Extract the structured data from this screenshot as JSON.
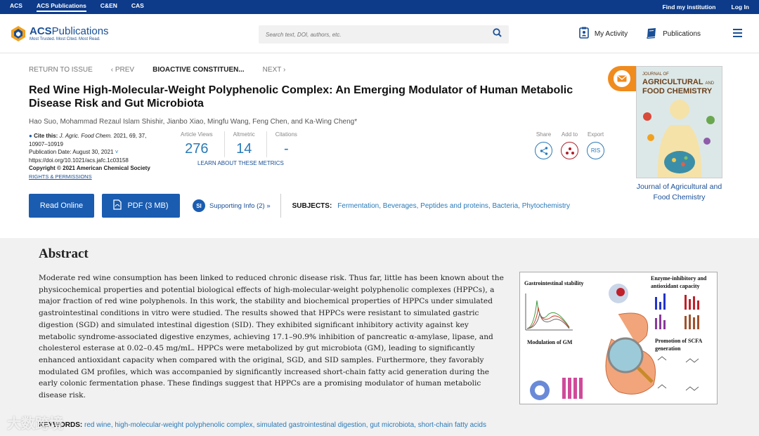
{
  "topbar": {
    "links": [
      "ACS",
      "ACS Publications",
      "C&EN",
      "CAS"
    ],
    "right": [
      "Find my institution",
      "Log In"
    ]
  },
  "header": {
    "logo_name": "ACS",
    "logo_name2": "Publications",
    "logo_tag": "Most Trusted. Most Cited. Most Read.",
    "search_placeholder": "Search text, DOI, authors, etc.",
    "my_activity": "My Activity",
    "publications": "Publications"
  },
  "nav": {
    "return": "RETURN TO ISSUE",
    "prev": "‹ PREV",
    "current": "BIOACTIVE CONSTITUEN...",
    "next": "NEXT ›"
  },
  "article": {
    "title": "Red Wine High-Molecular-Weight Polyphenolic Complex: An Emerging Modulator of Human Metabolic Disease Risk and Gut Microbiota",
    "authors": "Hao Suo, Mohammad Rezaul Islam Shishir, Jianbo Xiao, Mingfu Wang, Feng Chen, and Ka-Wing Cheng*",
    "cite_label": "Cite this:",
    "cite_journal": "J. Agric. Food Chem.",
    "cite_rest": "2021, 69, 37,",
    "pages": "10907–10919",
    "pub_date": "Publication Date: August 30, 2021",
    "doi": "https://doi.org/10.1021/acs.jafc.1c03158",
    "copyright": "Copyright © 2021 American Chemical Society",
    "rights": "RIGHTS & PERMISSIONS"
  },
  "metrics": [
    {
      "label": "Article Views",
      "value": "276"
    },
    {
      "label": "Altmetric",
      "value": "14"
    },
    {
      "label": "Citations",
      "value": "-"
    }
  ],
  "learn_metrics": "LEARN ABOUT THESE METRICS",
  "share": {
    "share": "Share",
    "add": "Add to",
    "export": "Export",
    "ris": "RIS"
  },
  "buttons": {
    "read": "Read Online",
    "pdf": "PDF (3 MB)",
    "si_badge": "SI",
    "si": "Supporting Info (2) »"
  },
  "subjects": {
    "label": "SUBJECTS:",
    "items": [
      "Fermentation",
      "Beverages",
      "Peptides and proteins",
      "Bacteria",
      "Phytochemistry"
    ]
  },
  "cover": {
    "small": "JOURNAL OF",
    "title1": "AGRICULTURAL",
    "title2": "FOOD CHEMISTRY",
    "and": "AND",
    "caption": "Journal of Agricultural and Food Chemistry"
  },
  "abstract": {
    "heading": "Abstract",
    "text": "Moderate red wine consumption has been linked to reduced chronic disease risk. Thus far, little has been known about the physicochemical properties and potential biological effects of high-molecular-weight polyphenolic complexes (HPPCs), a major fraction of red wine polyphenols. In this work, the stability and biochemical properties of HPPCs under simulated gastrointestinal conditions in vitro were studied. The results showed that HPPCs were resistant to simulated gastric digestion (SGD) and simulated intestinal digestion (SID). They exhibited significant inhibitory activity against key metabolic syndrome-associated digestive enzymes, achieving 17.1–90.9% inhibition of pancreatic α-amylase, lipase, and cholesterol esterase at 0.02–0.45 mg/mL. HPPCs were metabolized by gut microbiota (GM), leading to significantly enhanced antioxidant capacity when compared with the original, SGD, and SID samples. Furthermore, they favorably modulated GM profiles, which was accompanied by significantly increased short-chain fatty acid generation during the early colonic fermentation phase. These findings suggest that HPPCs are a promising modulator of human metabolic disease risk."
  },
  "toc": {
    "gi": "Gastrointestinal stability",
    "enzyme": "Enzyme-inhibitory and antioxidant capacity",
    "gm": "Modulation of GM",
    "scfa": "Promotion of SCFA generation"
  },
  "keywords": {
    "label": "KEYWORDS:",
    "text": "red wine, high-molecular-weight polyphenolic complex, simulated gastrointestinal digestion, gut microbiota, short-chain fatty acids"
  },
  "watermark": "大数跨境"
}
